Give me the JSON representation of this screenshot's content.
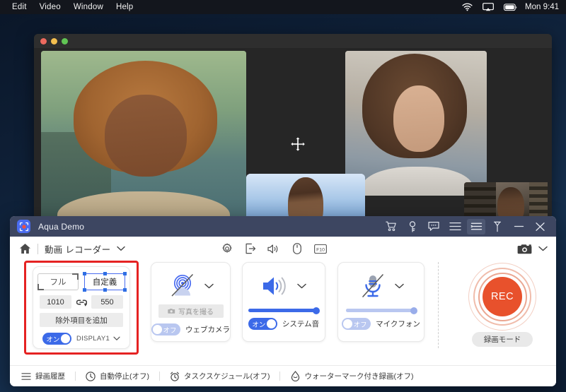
{
  "menubar": {
    "items": [
      "Edit",
      "Video",
      "Window",
      "Help"
    ],
    "clock": "Mon 9:41",
    "icons": [
      "wifi-icon",
      "airplay-icon",
      "battery-icon"
    ]
  },
  "call_window": {
    "participants": [
      {
        "name": "participant-tile-1"
      },
      {
        "name": "participant-tile-2"
      },
      {
        "name": "participant-tile-3"
      },
      {
        "name": "participant-tile-4"
      }
    ],
    "cursor": "move-cursor"
  },
  "app": {
    "title": "Aqua Demo",
    "titlebar_icons": [
      "cart-icon",
      "key-icon",
      "chat-icon",
      "menu-icon",
      "list-settings-icon",
      "pin-icon",
      "minimize-icon",
      "close-icon"
    ],
    "toolbar": {
      "home_icon": "home-icon",
      "mode_label": "動画 レコーダー",
      "mid_icons": [
        "gear-icon",
        "export-icon",
        "speaker-icon",
        "mouse-icon",
        "f10-key-icon"
      ],
      "camera_icon": "camera-icon"
    },
    "display_panel": {
      "full_label": "フル",
      "custom_label": "自定義",
      "width": "1010",
      "height": "550",
      "link_icon": "link-icon",
      "exclude_label": "除外項目を追加",
      "toggle_state": "オン",
      "display_name": "DISPLAY1"
    },
    "webcam_panel": {
      "icon": "webcam-off-icon",
      "photo_label": "写真を撮る",
      "toggle_state": "オフ",
      "label": "ウェブカメラ"
    },
    "sound_panel": {
      "icon": "speaker-on-icon",
      "toggle_state": "オン",
      "label": "システム音",
      "volume": 100
    },
    "mic_panel": {
      "icon": "mic-off-icon",
      "toggle_state": "オフ",
      "label": "マイクフォン",
      "volume": 100
    },
    "record": {
      "rec_label": "REC",
      "mode_label": "録画モード"
    },
    "statusbar": {
      "items": [
        {
          "icon": "history-icon",
          "label": "録画履歴"
        },
        {
          "icon": "clock-icon",
          "label": "自動停止(オフ)"
        },
        {
          "icon": "alarm-icon",
          "label": "タスクスケジュール(オフ)"
        },
        {
          "icon": "watermark-icon",
          "label": "ウォーターマーク付き録画(オフ)"
        }
      ]
    }
  },
  "colors": {
    "accent_blue": "#3c6ae8",
    "rec_red": "#e8512c",
    "highlight_red": "#e52222",
    "titlebar": "#3d4661"
  }
}
